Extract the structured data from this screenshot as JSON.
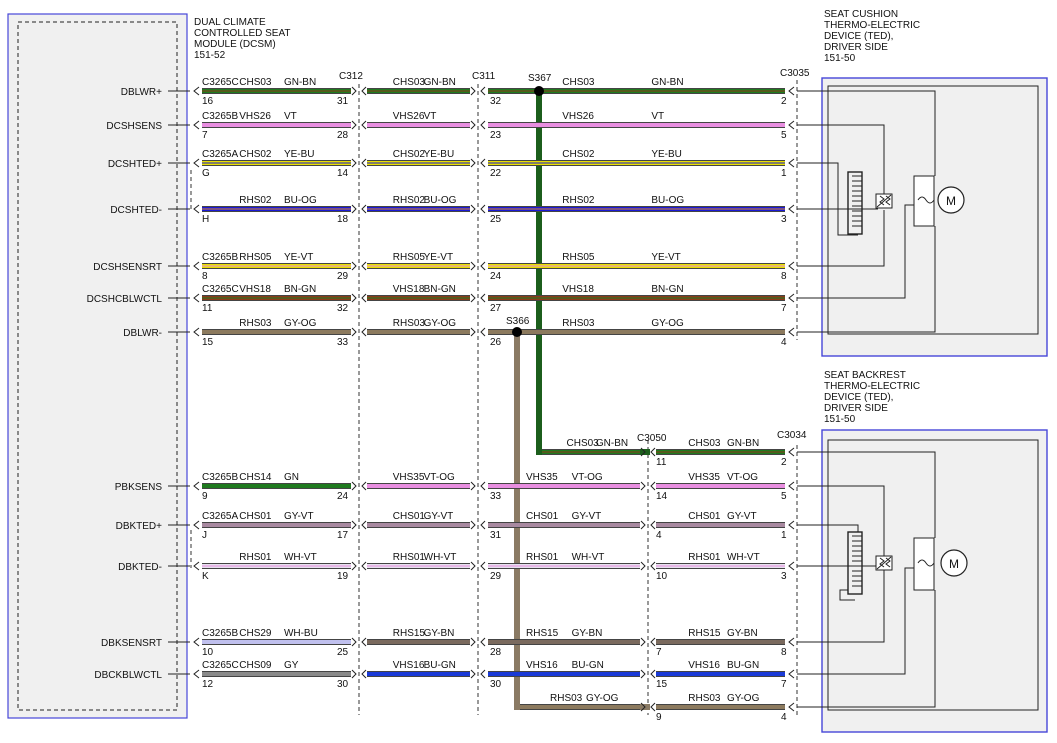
{
  "module": {
    "title_lines": [
      "DUAL CLIMATE",
      "CONTROLLED SEAT",
      "MODULE (DCSM)",
      "151-52"
    ]
  },
  "cushion": {
    "title_lines": [
      "SEAT CUSHION",
      "THERMO-ELECTRIC",
      "DEVICE (TED),",
      "DRIVER SIDE",
      "151-50"
    ],
    "connector": "C3035",
    "motor_label": "M"
  },
  "backrest": {
    "title_lines": [
      "SEAT BACKREST",
      "THERMO-ELECTRIC",
      "DEVICE (TED),",
      "DRIVER SIDE",
      "151-50"
    ],
    "connector": "C3034",
    "motor_label": "M"
  },
  "inline_connectors": {
    "c312": "C312",
    "c311": "C311",
    "c3050": "C3050"
  },
  "splices": {
    "s367": "S367",
    "s366": "S366"
  },
  "colors": {
    "GN": "#1f7a1f",
    "VT": "#e88ee0",
    "VT-OG": "#e88ee0",
    "YE": "#e8e000",
    "BU": "#1a1ad6",
    "BN": "#8b3a1a",
    "GY": "#8a8a8a",
    "GY-OG": "#8c7a5e",
    "GY-VT": "#a889a0",
    "WH": "#e6e0ee",
    "GY-BN": "#7a6a5e",
    "WH-BU": "#c0c0ee",
    "BU-GN": "#1a3ad6",
    "trunk_green": "#1c5e1c",
    "trunk_grey": "#8a7a64",
    "panel_border": "#3a3adb"
  },
  "wires": [
    {
      "pin_label": "DBLWR+",
      "module_conn": "C3265C",
      "module_pin": "16",
      "seg1": {
        "circuit": "CHS03",
        "color": "GN-BN"
      },
      "c312_pin": "31",
      "seg2": {
        "circuit": "CHS03",
        "color": "GN-BN"
      },
      "c311_pin": "32",
      "seg3": {
        "circuit": "CHS03",
        "color": "GN-BN"
      },
      "dev_pin": "2"
    },
    {
      "pin_label": "DCSHSENS",
      "module_conn": "C3265B",
      "module_pin": "7",
      "seg1": {
        "circuit": "VHS26",
        "color": "VT"
      },
      "c312_pin": "28",
      "seg2": {
        "circuit": "VHS26",
        "color": "VT"
      },
      "c311_pin": "23",
      "seg3": {
        "circuit": "VHS26",
        "color": "VT"
      },
      "dev_pin": "5"
    },
    {
      "pin_label": "DCSHTED+",
      "module_conn": "C3265A",
      "module_pin": "G",
      "seg1": {
        "circuit": "CHS02",
        "color": "YE-BU"
      },
      "c312_pin": "14",
      "seg2": {
        "circuit": "CHS02",
        "color": "YE-BU"
      },
      "c311_pin": "22",
      "seg3": {
        "circuit": "CHS02",
        "color": "YE-BU"
      },
      "dev_pin": "1"
    },
    {
      "pin_label": "DCSHTED-",
      "module_conn": "",
      "module_pin": "H",
      "seg1": {
        "circuit": "RHS02",
        "color": "BU-OG"
      },
      "c312_pin": "18",
      "seg2": {
        "circuit": "RHS02",
        "color": "BU-OG"
      },
      "c311_pin": "25",
      "seg3": {
        "circuit": "RHS02",
        "color": "BU-OG"
      },
      "dev_pin": "3"
    },
    {
      "pin_label": "DCSHSENSRT",
      "module_conn": "C3265B",
      "module_pin": "8",
      "seg1": {
        "circuit": "RHS05",
        "color": "YE-VT"
      },
      "c312_pin": "29",
      "seg2": {
        "circuit": "RHS05",
        "color": "YE-VT"
      },
      "c311_pin": "24",
      "seg3": {
        "circuit": "RHS05",
        "color": "YE-VT"
      },
      "dev_pin": "8"
    },
    {
      "pin_label": "DCSHCBLWCTL",
      "module_conn": "C3265C",
      "module_pin": "11",
      "seg1": {
        "circuit": "VHS18",
        "color": "BN-GN"
      },
      "c312_pin": "32",
      "seg2": {
        "circuit": "VHS18",
        "color": "BN-GN"
      },
      "c311_pin": "27",
      "seg3": {
        "circuit": "VHS18",
        "color": "BN-GN"
      },
      "dev_pin": "7"
    },
    {
      "pin_label": "DBLWR-",
      "module_conn": "",
      "module_pin": "15",
      "seg1": {
        "circuit": "RHS03",
        "color": "GY-OG"
      },
      "c312_pin": "33",
      "seg2": {
        "circuit": "RHS03",
        "color": "GY-OG"
      },
      "c311_pin": "26",
      "seg3": {
        "circuit": "RHS03",
        "color": "GY-OG"
      },
      "dev_pin": "4"
    },
    {
      "pin_label": "PBKSENS",
      "module_conn": "C3265B",
      "module_pin": "9",
      "seg1": {
        "circuit": "CHS14",
        "color": "GN"
      },
      "c312_pin": "24",
      "seg2": {
        "circuit": "VHS35",
        "color": "VT-OG"
      },
      "c311_pin": "33",
      "seg3": {
        "circuit": "VHS35",
        "color": "VT-OG"
      },
      "c3050_pin": "14",
      "seg4": {
        "circuit": "VHS35",
        "color": "VT-OG"
      },
      "dev_pin": "5"
    },
    {
      "pin_label": "DBKTED+",
      "module_conn": "C3265A",
      "module_pin": "J",
      "seg1": {
        "circuit": "CHS01",
        "color": "GY-VT"
      },
      "c312_pin": "17",
      "seg2": {
        "circuit": "CHS01",
        "color": "GY-VT"
      },
      "c311_pin": "31",
      "seg3": {
        "circuit": "CHS01",
        "color": "GY-VT"
      },
      "c3050_pin": "4",
      "seg4": {
        "circuit": "CHS01",
        "color": "GY-VT"
      },
      "dev_pin": "1"
    },
    {
      "pin_label": "DBKTED-",
      "module_conn": "",
      "module_pin": "K",
      "seg1": {
        "circuit": "RHS01",
        "color": "WH-VT"
      },
      "c312_pin": "19",
      "seg2": {
        "circuit": "RHS01",
        "color": "WH-VT"
      },
      "c311_pin": "29",
      "seg3": {
        "circuit": "RHS01",
        "color": "WH-VT"
      },
      "c3050_pin": "10",
      "seg4": {
        "circuit": "RHS01",
        "color": "WH-VT"
      },
      "dev_pin": "3"
    },
    {
      "pin_label": "DBKSENSRT",
      "module_conn": "C3265B",
      "module_pin": "10",
      "seg1": {
        "circuit": "CHS29",
        "color": "WH-BU"
      },
      "c312_pin": "25",
      "seg2": {
        "circuit": "RHS15",
        "color": "GY-BN"
      },
      "c311_pin": "28",
      "seg3": {
        "circuit": "RHS15",
        "color": "GY-BN"
      },
      "c3050_pin": "7",
      "seg4": {
        "circuit": "RHS15",
        "color": "GY-BN"
      },
      "dev_pin": "8"
    },
    {
      "pin_label": "DBCKBLWCTL",
      "module_conn": "C3265C",
      "module_pin": "12",
      "seg1": {
        "circuit": "CHS09",
        "color": "GY"
      },
      "c312_pin": "30",
      "seg2": {
        "circuit": "VHS16",
        "color": "BU-GN"
      },
      "c311_pin": "30",
      "seg3": {
        "circuit": "VHS16",
        "color": "BU-GN"
      },
      "c3050_pin": "15",
      "seg4": {
        "circuit": "VHS16",
        "color": "BU-GN"
      },
      "dev_pin": "7"
    }
  ],
  "branch_power": {
    "seg3": {
      "circuit": "CHS03",
      "color": "GN-BN"
    },
    "c3050_pin": "11",
    "seg4": {
      "circuit": "CHS03",
      "color": "GN-BN"
    },
    "dev_pin": "2"
  },
  "branch_ground": {
    "seg3": {
      "circuit": "RHS03",
      "color": "GY-OG"
    },
    "c3050_pin": "9",
    "seg4": {
      "circuit": "RHS03",
      "color": "GY-OG"
    },
    "dev_pin": "4"
  }
}
